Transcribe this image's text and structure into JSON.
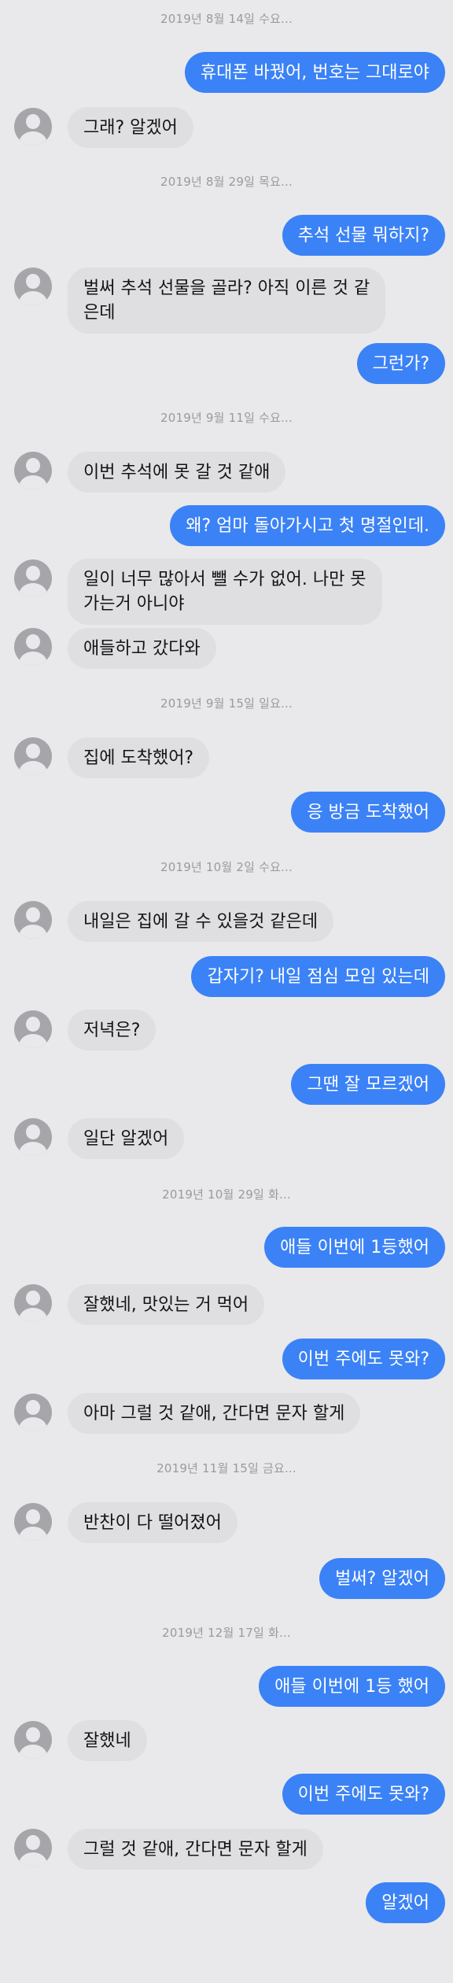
{
  "thread": [
    {
      "kind": "timestamp",
      "text": "2019년 8월 14일 수요..."
    },
    {
      "kind": "out",
      "text": "휴대폰 바꿨어, 번호는 그대로야"
    },
    {
      "kind": "in",
      "text": "그래? 알겠어"
    },
    {
      "kind": "timestamp",
      "text": "2019년 8월 29일 목요..."
    },
    {
      "kind": "out",
      "text": "추석 선물 뭐하지?"
    },
    {
      "kind": "in",
      "text": "벌써 추석 선물을 골라? 아직 이른 것 같\n은데"
    },
    {
      "kind": "out",
      "text": "그런가?"
    },
    {
      "kind": "timestamp",
      "text": "2019년 9월 11일 수요..."
    },
    {
      "kind": "in",
      "text": "이번 추석에 못 갈 것 같애"
    },
    {
      "kind": "out",
      "text": "왜? 엄마 돌아가시고 첫 명절인데."
    },
    {
      "kind": "in",
      "text": "일이 너무 많아서 뺄 수가 없어. 나만 못\n 가는거 아니야"
    },
    {
      "kind": "in",
      "text": "애들하고 갔다와"
    },
    {
      "kind": "timestamp",
      "text": "2019년 9월 15일 일요..."
    },
    {
      "kind": "in",
      "text": "집에 도착했어?"
    },
    {
      "kind": "out",
      "text": "응 방금 도착했어"
    },
    {
      "kind": "timestamp",
      "text": "2019년 10월 2일 수요..."
    },
    {
      "kind": "in",
      "text": "내일은 집에 갈 수 있을것 같은데"
    },
    {
      "kind": "out",
      "text": "갑자기? 내일 점심 모임 있는데"
    },
    {
      "kind": "in",
      "text": "저녁은?"
    },
    {
      "kind": "out",
      "text": "그땐 잘 모르겠어"
    },
    {
      "kind": "in",
      "text": "일단 알겠어"
    },
    {
      "kind": "timestamp",
      "text": "2019년 10월 29일 화..."
    },
    {
      "kind": "out",
      "text": "애들 이번에 1등했어"
    },
    {
      "kind": "in",
      "text": "잘했네, 맛있는 거 먹어"
    },
    {
      "kind": "out",
      "text": "이번 주에도 못와?"
    },
    {
      "kind": "in",
      "text": "아마 그럴 것 같애, 간다면 문자 할게"
    },
    {
      "kind": "timestamp",
      "text": "2019년 11월 15일 금요..."
    },
    {
      "kind": "in",
      "text": "반찬이 다 떨어졌어"
    },
    {
      "kind": "out",
      "text": "벌써? 알겠어"
    },
    {
      "kind": "timestamp",
      "text": "2019년 12월 17일 화..."
    },
    {
      "kind": "out",
      "text": "애들 이번에 1등 했어"
    },
    {
      "kind": "in",
      "text": "잘했네"
    },
    {
      "kind": "out",
      "text": "이번 주에도 못와?"
    },
    {
      "kind": "in",
      "text": "그럴 것 같애, 간다면 문자 할게"
    },
    {
      "kind": "out",
      "text": "알겠어"
    }
  ]
}
